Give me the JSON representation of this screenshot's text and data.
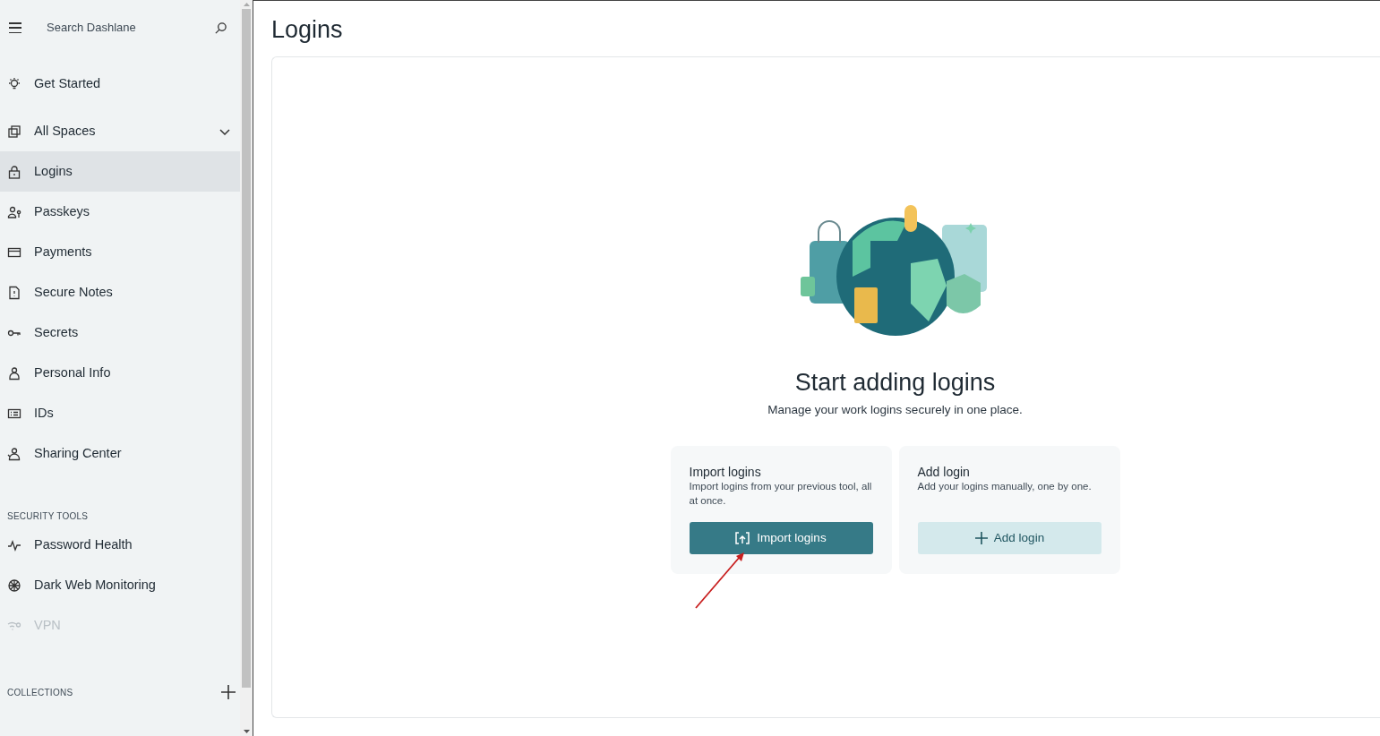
{
  "sidebar": {
    "search": {
      "placeholder": "Search Dashlane"
    },
    "top_items": [
      {
        "label": "Get Started",
        "selected": false
      }
    ],
    "spaces": {
      "label": "All Spaces",
      "expanded": false
    },
    "items": [
      {
        "label": "Logins",
        "selected": true
      },
      {
        "label": "Passkeys",
        "selected": false
      },
      {
        "label": "Payments",
        "selected": false
      },
      {
        "label": "Secure Notes",
        "selected": false
      },
      {
        "label": "Secrets",
        "selected": false
      },
      {
        "label": "Personal Info",
        "selected": false
      },
      {
        "label": "IDs",
        "selected": false
      },
      {
        "label": "Sharing Center",
        "selected": false
      }
    ],
    "security_tools": {
      "heading": "SECURITY TOOLS",
      "items": [
        {
          "label": "Password Health",
          "disabled": false
        },
        {
          "label": "Dark Web Monitoring",
          "disabled": false
        },
        {
          "label": "VPN",
          "disabled": true
        }
      ]
    },
    "collections": {
      "heading": "COLLECTIONS"
    }
  },
  "page": {
    "title": "Logins"
  },
  "empty_state": {
    "title": "Start adding logins",
    "subtitle": "Manage your work logins securely in one place.",
    "cards": [
      {
        "kind": "import",
        "title": "Import logins",
        "description": "Import logins from your previous tool, all at once.",
        "button": "Import logins"
      },
      {
        "kind": "add",
        "title": "Add login",
        "description": "Add your logins manually, one by one.",
        "button": "Add login"
      }
    ]
  }
}
